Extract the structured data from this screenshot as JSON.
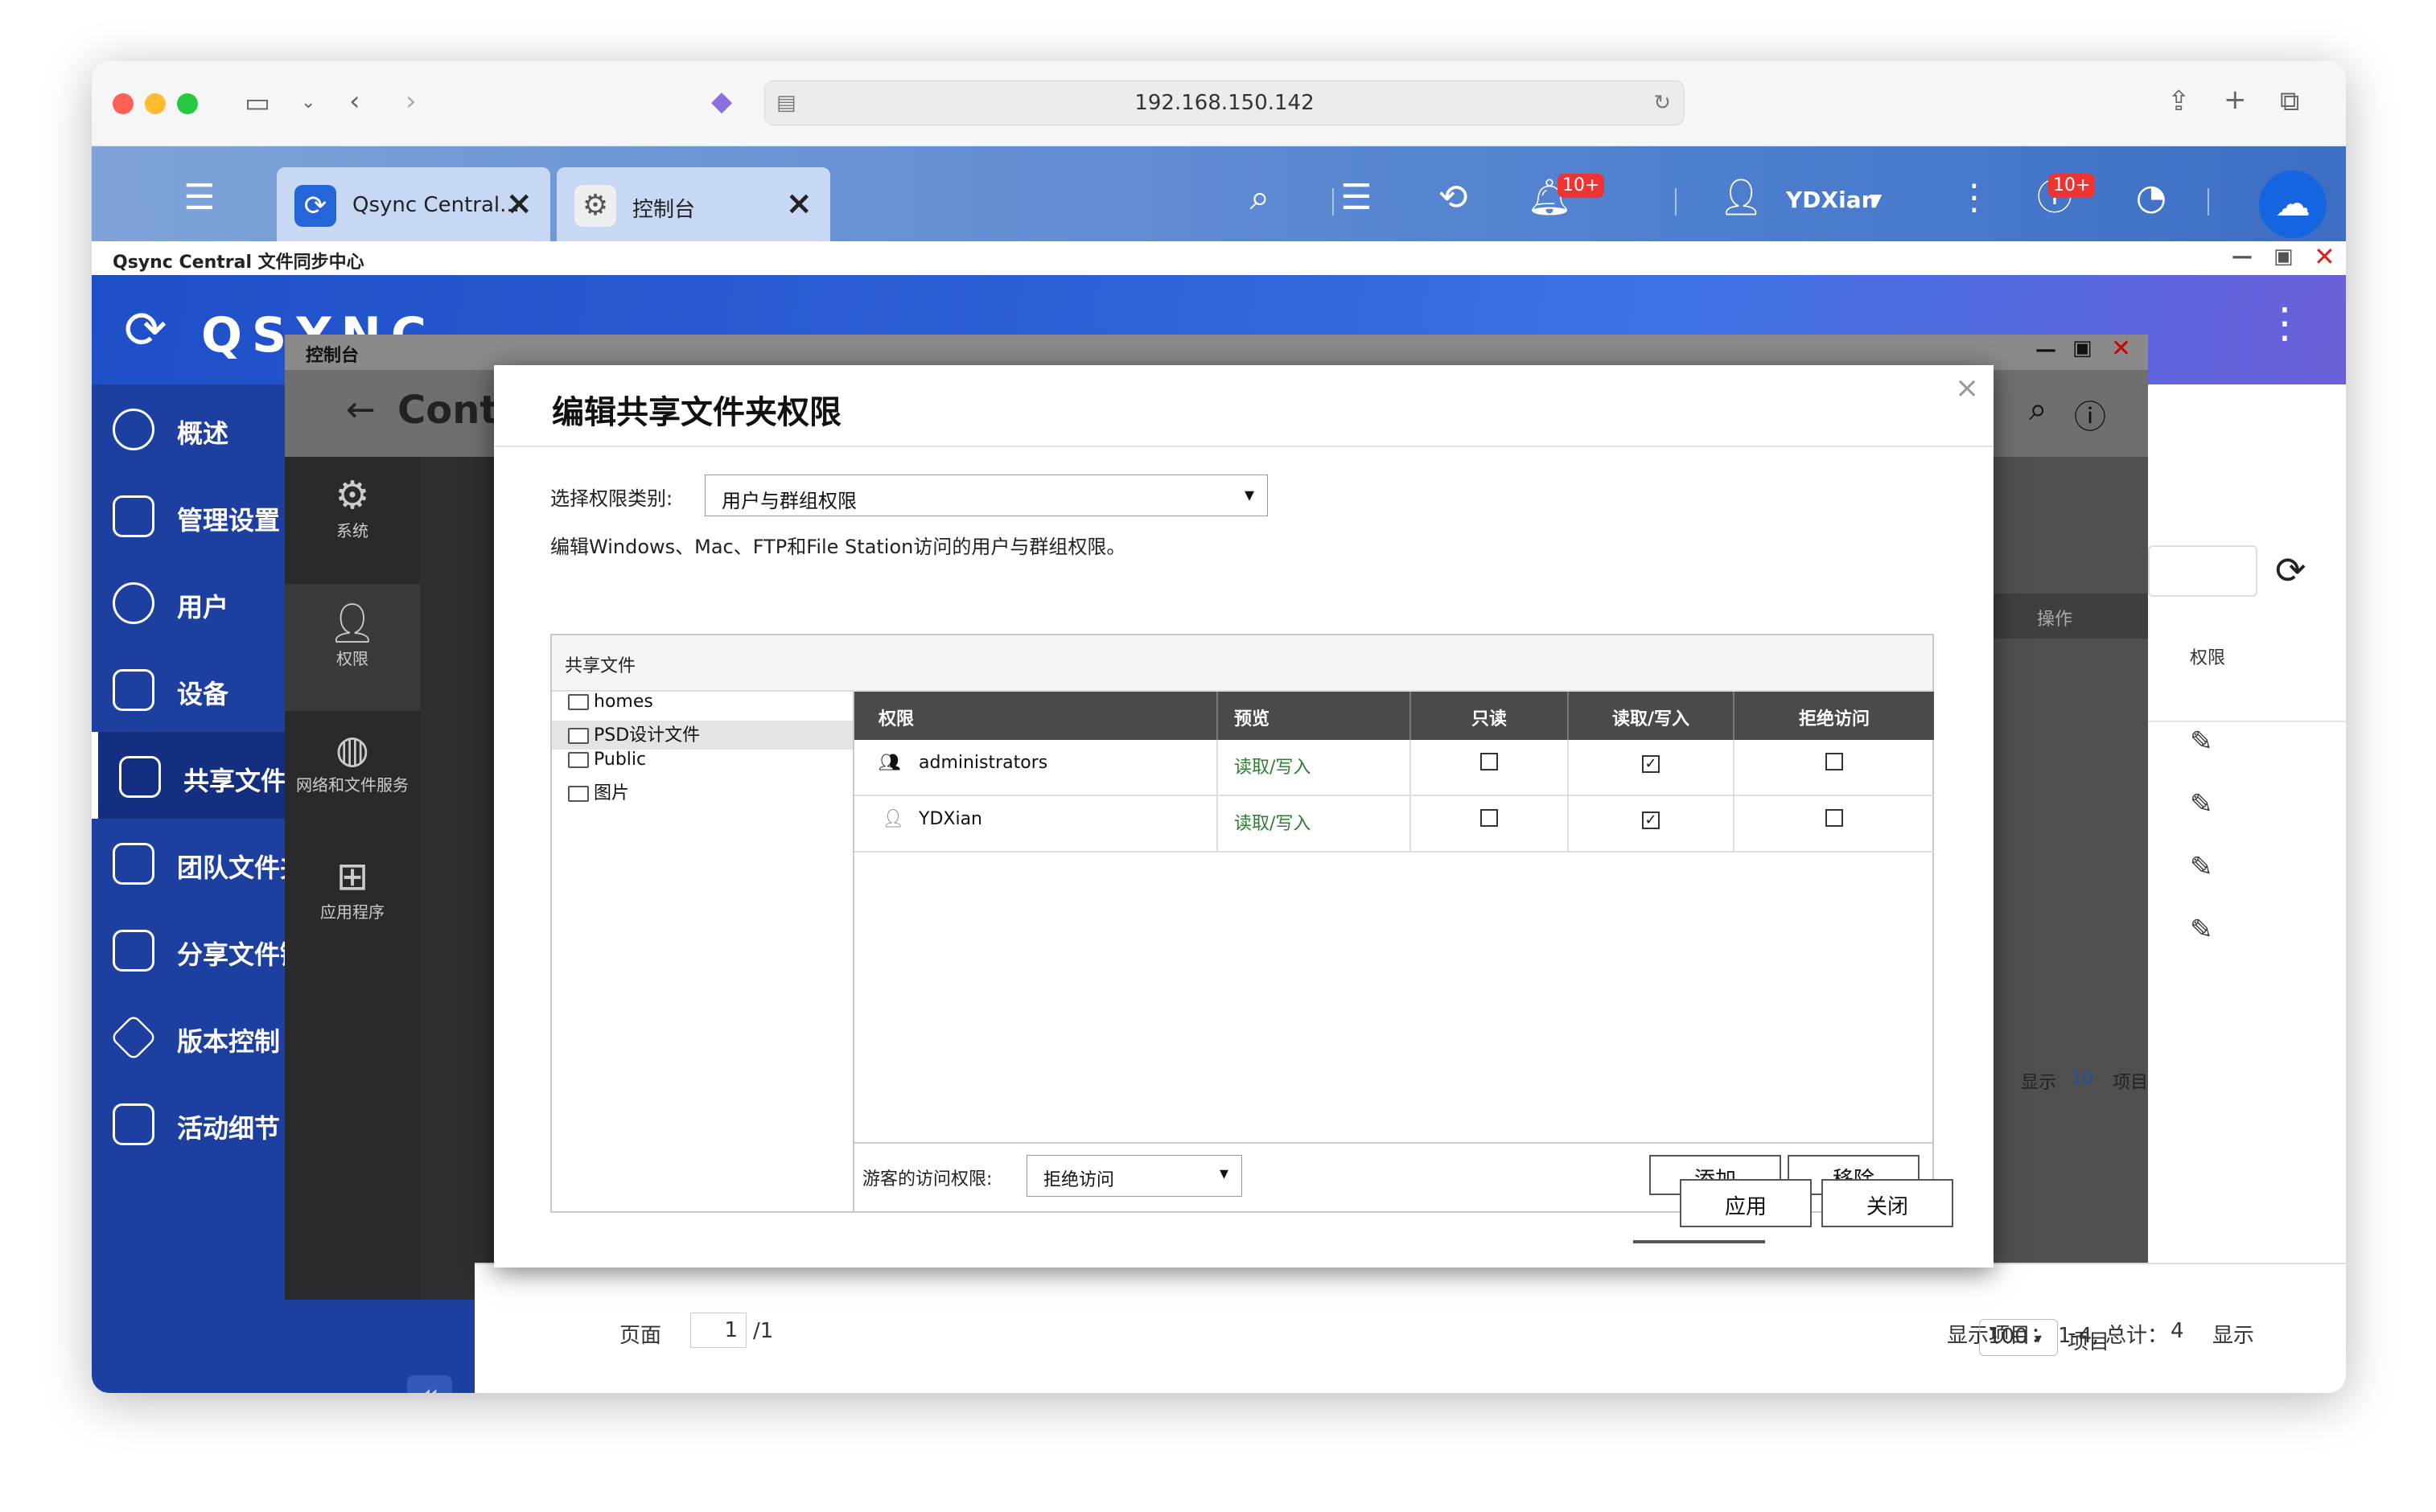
{
  "browser": {
    "url": "192.168.150.142"
  },
  "qts": {
    "tabs": [
      {
        "label": "Qsync Central..."
      },
      {
        "label": "控制台"
      }
    ],
    "notif_badge": "10+",
    "update_badge": "10+",
    "user": "YDXian"
  },
  "app": {
    "title": "Qsync Central 文件同步中心",
    "logo_text": "QSYNC"
  },
  "sidebar": {
    "items": [
      {
        "label": "概述"
      },
      {
        "label": "管理设置"
      },
      {
        "label": "用户"
      },
      {
        "label": "设备"
      },
      {
        "label": "共享文件夹"
      },
      {
        "label": "团队文件夹"
      },
      {
        "label": "分享文件链接"
      },
      {
        "label": "版本控制"
      },
      {
        "label": "活动细节"
      }
    ],
    "collapse": "«"
  },
  "controlpanel": {
    "title": "控制台",
    "header": "Control Panel",
    "categories": [
      {
        "label": "系统"
      },
      {
        "label": "权限"
      },
      {
        "label": "网络和文件服务"
      },
      {
        "label": "应用程序"
      }
    ],
    "col_action": "操作",
    "col_perm": "权限",
    "show": "显示",
    "show_count": "10",
    "items": "项目"
  },
  "dialog": {
    "title": "编辑共享文件夹权限",
    "category_label": "选择权限类别:",
    "category_value": "用户与群组权限",
    "description": "编辑Windows、Mac、FTP和File Station访问的用户与群组权限。",
    "panel_title": "共享文件",
    "tree": [
      "homes",
      "PSD设计文件",
      "Public",
      "图片"
    ],
    "columns": [
      "权限",
      "预览",
      "只读",
      "读取/写入",
      "拒绝访问"
    ],
    "rows": [
      {
        "name": "administrators",
        "preview": "读取/写入",
        "read_only": false,
        "read_write": true,
        "deny": false
      },
      {
        "name": "YDXian",
        "preview": "读取/写入",
        "read_only": false,
        "read_write": true,
        "deny": false
      }
    ],
    "guest_label": "游客的访问权限:",
    "guest_value": "拒绝访问",
    "add": "添加",
    "remove": "移除",
    "apply": "应用",
    "close": "关闭"
  },
  "pager": {
    "page_label": "页面",
    "page": "1",
    "total_pages": "/1",
    "display_items": "显示项目：",
    "range": "1-4, 总计：",
    "total": "4",
    "show": "显示",
    "per_page": "100",
    "items": "项目"
  },
  "colors": {
    "brand": "#1d3fa0",
    "header": "#2d61d8"
  }
}
